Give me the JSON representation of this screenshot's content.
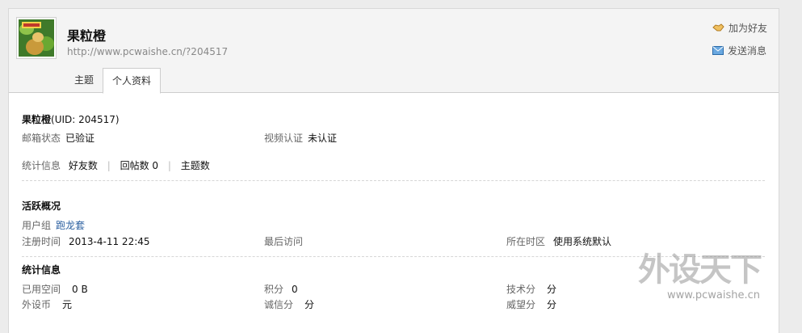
{
  "profile": {
    "username": "果粒橙",
    "home_url": "http://www.pcwaishe.cn/?204517"
  },
  "actions": {
    "add_friend": "加为好友",
    "send_message": "发送消息"
  },
  "tabs": [
    {
      "label": "主题",
      "active": false
    },
    {
      "label": "个人资料",
      "active": true
    }
  ],
  "basic": {
    "name": "果粒橙",
    "uid": "(UID: 204517)",
    "email_label": "邮箱状态",
    "email_value": "已验证",
    "video_label": "视频认证",
    "video_value": "未认证",
    "stats_label": "统计信息",
    "friends_label": "好友数",
    "replies_label": "回帖数",
    "replies_value": "0",
    "threads_label": "主题数"
  },
  "activity": {
    "heading": "活跃概况",
    "group_label": "用户组",
    "group_value": "跑龙套",
    "register_label": "注册时间",
    "register_value": "2013-4-11 22:45",
    "last_visit_label": "最后访问",
    "timezone_label": "所在时区",
    "timezone_value": "使用系统默认"
  },
  "stats": {
    "heading": "统计信息",
    "space_label": "已用空间",
    "space_value": "0 B",
    "points_label": "积分",
    "points_value": "0",
    "tech_label": "技术分",
    "tech_value": "分",
    "coin_label": "外设币",
    "coin_value": "元",
    "credit_label": "诚信分",
    "credit_value": "分",
    "prestige_label": "威望分",
    "prestige_value": "分"
  },
  "watermark": {
    "title": "外设天下",
    "url": "www.pcwaishe.cn"
  }
}
